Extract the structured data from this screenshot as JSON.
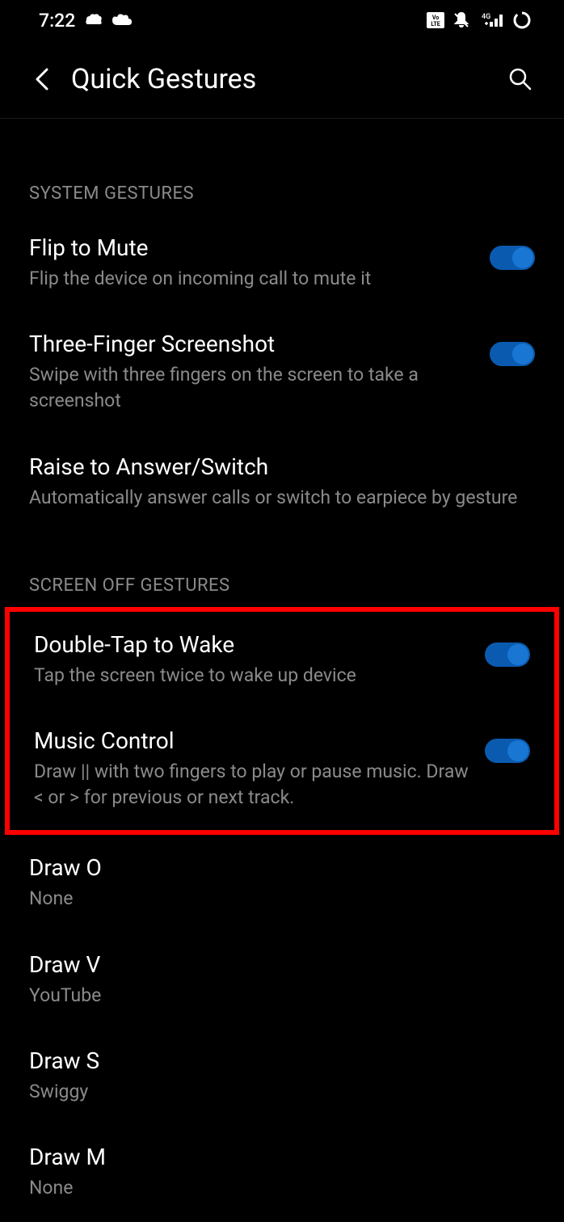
{
  "status_bar": {
    "time": "7:22",
    "volte": "VoLTE",
    "network": "4G"
  },
  "header": {
    "title": "Quick Gestures"
  },
  "sections": {
    "system_gestures": {
      "label": "SYSTEM GESTURES",
      "items": {
        "flip_to_mute": {
          "title": "Flip to Mute",
          "desc": "Flip the device on incoming call to mute it"
        },
        "three_finger": {
          "title": "Three-Finger Screenshot",
          "desc": "Swipe with three fingers on the screen to take a screenshot"
        },
        "raise_to_answer": {
          "title": "Raise to Answer/Switch",
          "desc": "Automatically answer calls or switch to earpiece by gesture"
        }
      }
    },
    "screen_off": {
      "label": "SCREEN OFF GESTURES",
      "items": {
        "double_tap": {
          "title": "Double-Tap to Wake",
          "desc": "Tap the screen twice to wake up device"
        },
        "music_control": {
          "title": "Music Control",
          "desc": "Draw || with two fingers to play or pause music. Draw < or > for previous or next track."
        },
        "draw_o": {
          "title": "Draw O",
          "desc": "None"
        },
        "draw_v": {
          "title": "Draw V",
          "desc": "YouTube"
        },
        "draw_s": {
          "title": "Draw S",
          "desc": "Swiggy"
        },
        "draw_m": {
          "title": "Draw M",
          "desc": "None"
        }
      }
    }
  }
}
